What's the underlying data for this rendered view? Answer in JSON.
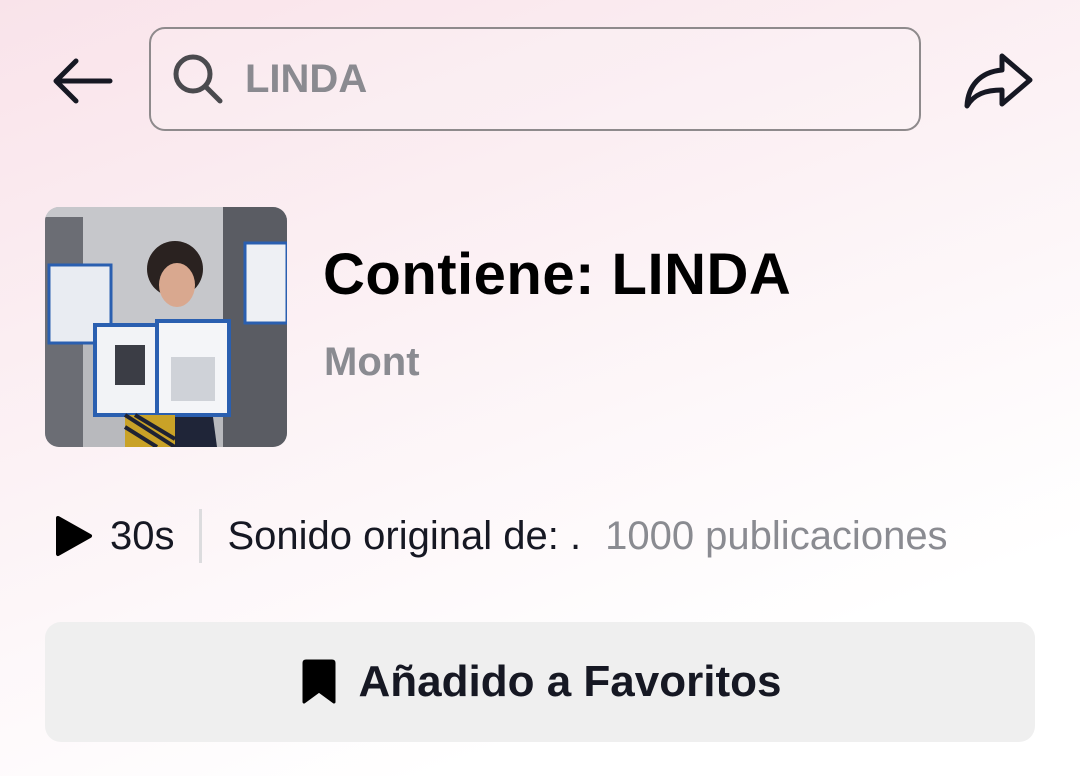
{
  "header": {
    "back_icon": "arrow-left-icon",
    "search": {
      "icon": "search-icon",
      "value": "LINDA",
      "placeholder": ""
    },
    "share_icon": "share-arrow-icon"
  },
  "sound": {
    "title": "Contiene: LINDA",
    "artist": "Mont",
    "cover_label": "album-cover"
  },
  "info": {
    "play_icon": "play-icon",
    "duration": "30s",
    "original_sound": "Sonido original de: .",
    "post_count": "1000 publicaciones"
  },
  "favorites": {
    "icon": "bookmark-icon",
    "label": "Añadido a Favoritos"
  },
  "colors": {
    "background_top": "#f9e3ea",
    "text_primary": "#161823",
    "text_secondary": "#8a8b91",
    "button_bg": "#efefef"
  }
}
